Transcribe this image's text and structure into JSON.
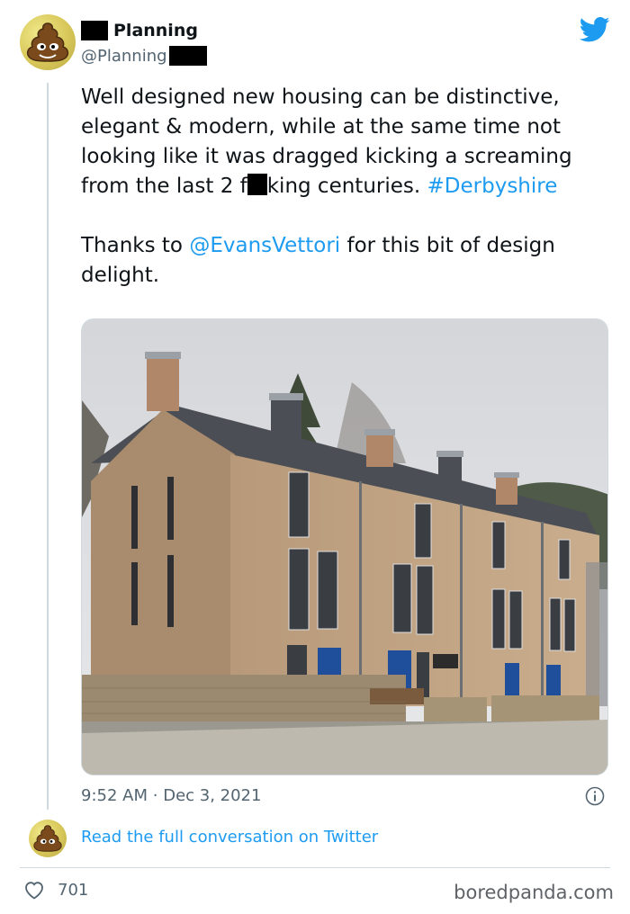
{
  "author": {
    "display_name": "Planning",
    "handle": "@Planning"
  },
  "tweet": {
    "paragraph1": "Well designed new housing can be distinctive, elegant & modern, while at the same time not looking like it was dragged kicking a screaming from the last 2 f",
    "paragraph1_after_redaction": "king centuries.",
    "hashtag": "#Derbyshire",
    "paragraph2_start": "Thanks to",
    "mention": "@EvansVettori",
    "paragraph2_end": "for this bit of design delight."
  },
  "meta": {
    "time": "9:52 AM",
    "separator": "·",
    "date": "Dec 3, 2021"
  },
  "actions": {
    "read_conversation": "Read the full conversation on Twitter",
    "like_count": "701"
  },
  "watermark": "boredpanda.com",
  "colors": {
    "link": "#1d9bf0",
    "twitter_blue": "#1d9bf0",
    "muted": "#536471"
  },
  "icons": [
    "twitter-bird-icon",
    "info-icon",
    "heart-icon",
    "poop-emoji-avatar"
  ]
}
